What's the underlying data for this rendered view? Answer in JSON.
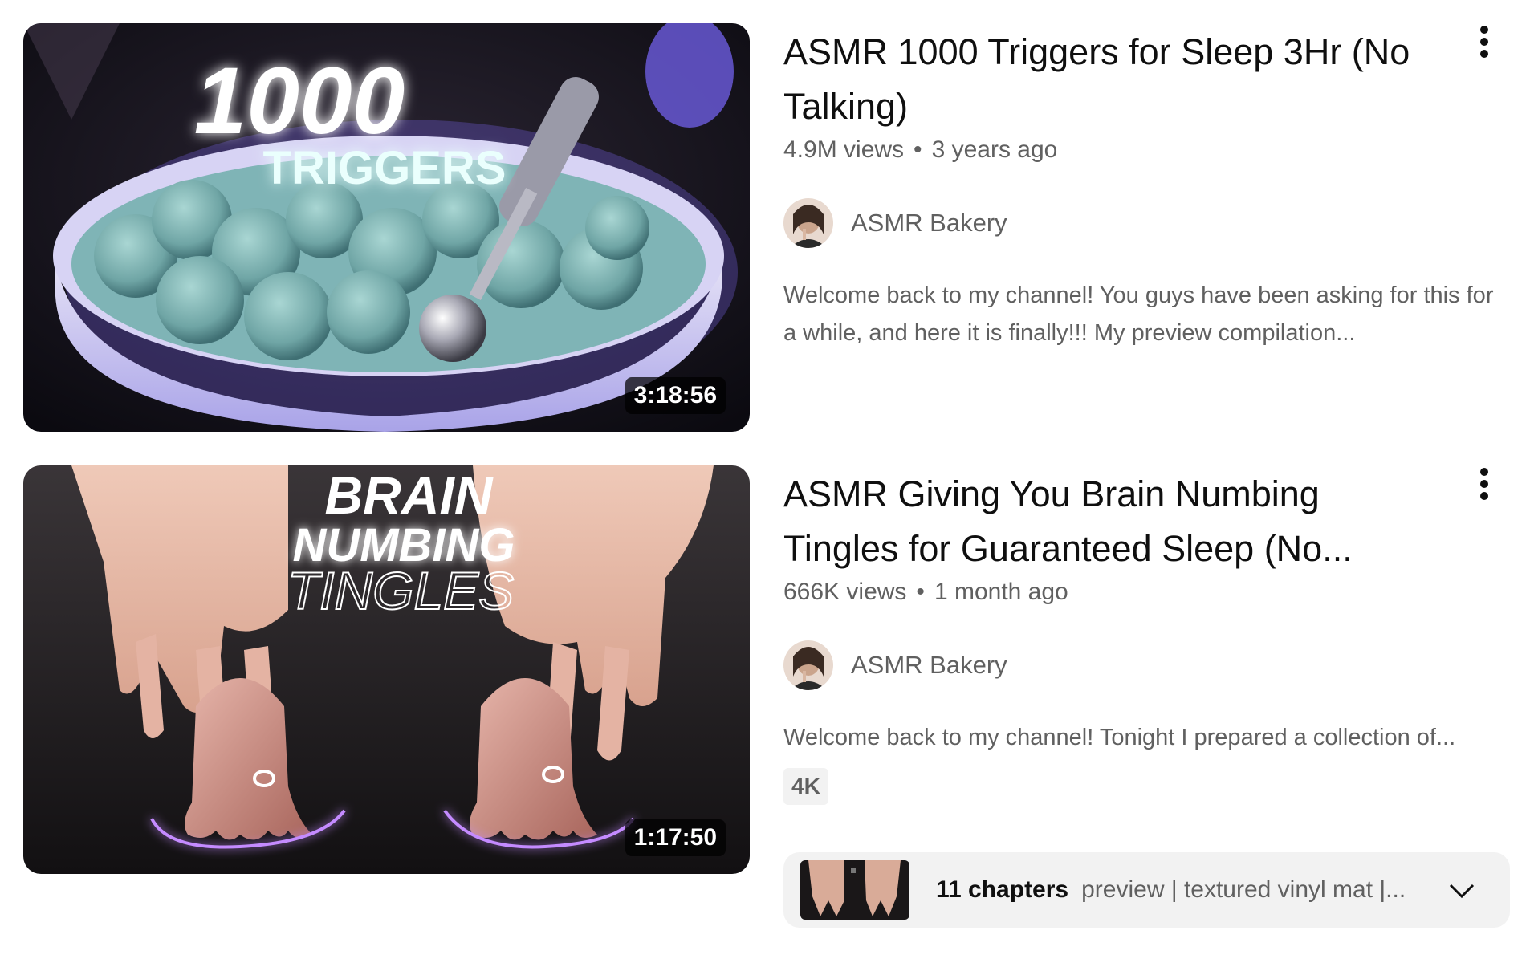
{
  "results": [
    {
      "title": "ASMR 1000 Triggers for Sleep 3Hr (No Talking)",
      "thumbnail_text_1": "1000",
      "thumbnail_text_2": "TRIGGERS",
      "duration": "3:18:56",
      "views": "4.9M views",
      "separator": "•",
      "age": "3 years ago",
      "channel": "ASMR Bakery",
      "description": "Welcome back to my channel! You guys have been asking for this for a while, and here it is finally!!! My preview compilation...",
      "menu_icon": "more-vert-icon"
    },
    {
      "title": "ASMR Giving You Brain Numbing Tingles for Guaranteed Sleep (No...",
      "thumbnail_text_1": "BRAIN",
      "thumbnail_text_2": "NUMBING",
      "thumbnail_text_3": "TINGLES",
      "duration": "1:17:50",
      "views": "666K views",
      "separator": "•",
      "age": "1 month ago",
      "channel": "ASMR Bakery",
      "description": "Welcome back to my channel! Tonight I prepared a collection of...",
      "badge": "4K",
      "chapters_count": "11 chapters",
      "chapters_text": "preview | textured vinyl mat |...",
      "chevron_icon": "chevron-down-icon",
      "menu_icon": "more-vert-icon"
    }
  ],
  "colors": {
    "title": "#0f0f0f",
    "secondary": "#606060",
    "chip_bg": "#f2f2f2",
    "glow_purple": "#8a3cff",
    "glow_teal": "#7fe8e0"
  }
}
